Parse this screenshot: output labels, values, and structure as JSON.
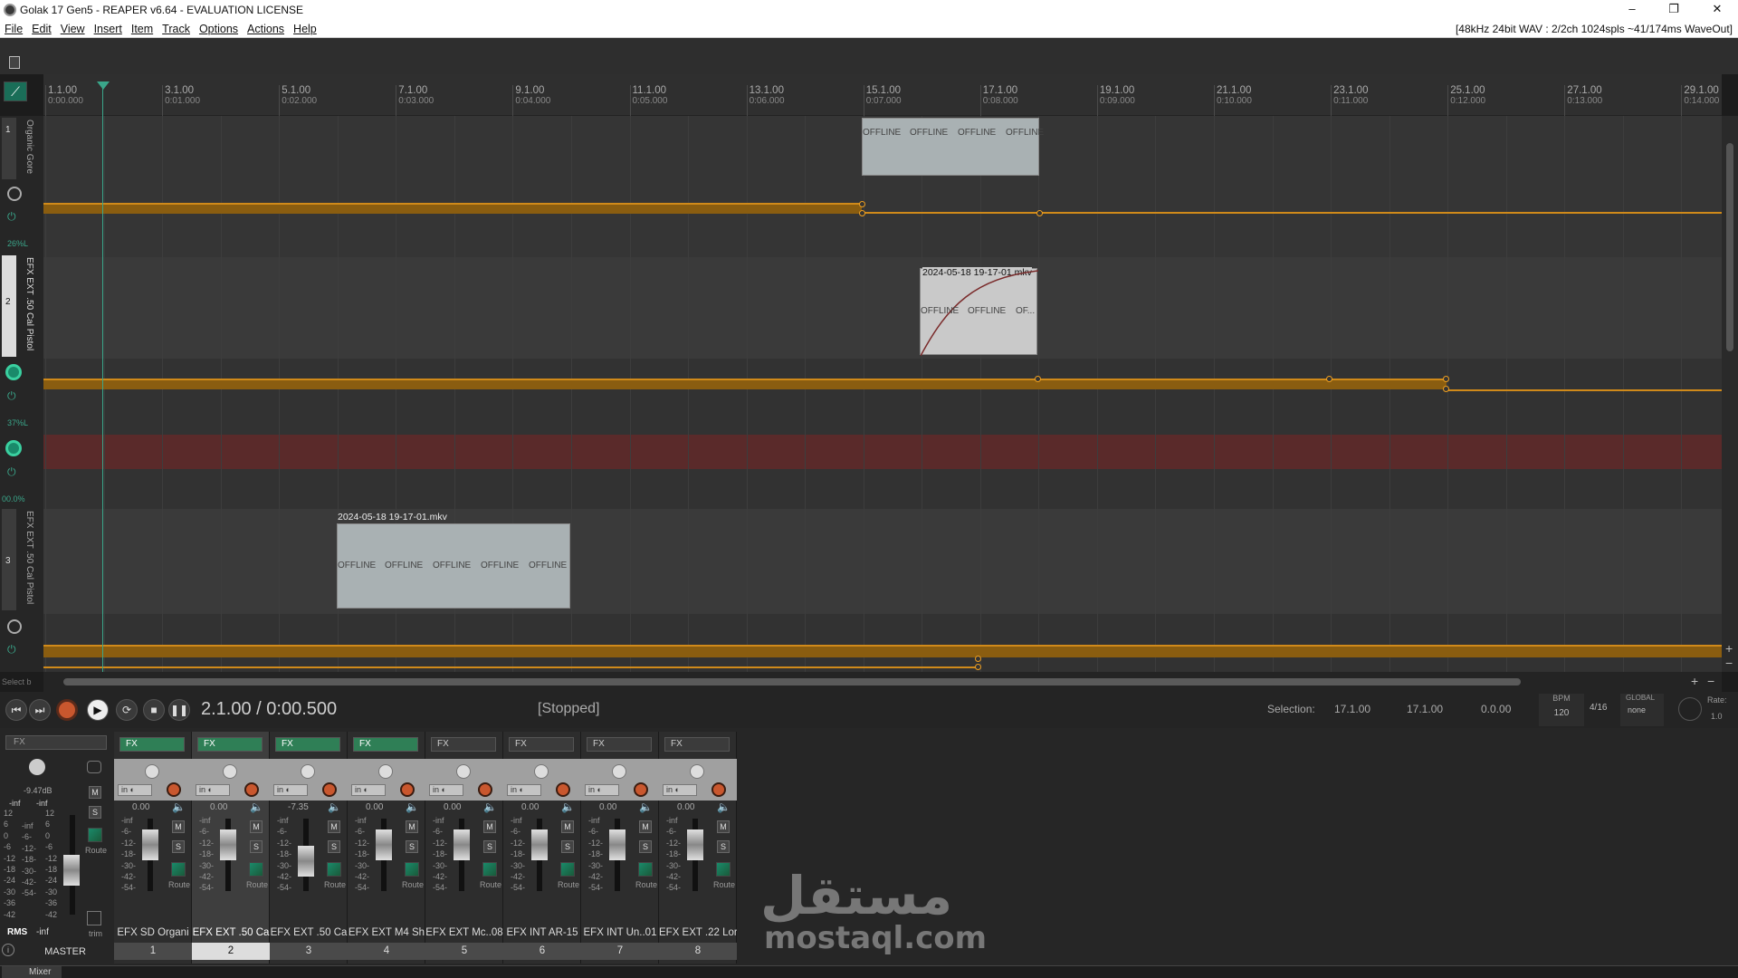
{
  "window": {
    "title": "Golak 17 Gen5 - REAPER v6.64 - EVALUATION LICENSE",
    "min": "–",
    "max": "❐",
    "close": "✕"
  },
  "menu": {
    "items": [
      "File",
      "Edit",
      "View",
      "Insert",
      "Item",
      "Track",
      "Options",
      "Actions",
      "Help"
    ],
    "audio_info": "[48kHz 24bit WAV : 2/2ch 1024spls ~41/174ms WaveOut]"
  },
  "ruler": {
    "marks": [
      {
        "bar": "1.1.00",
        "time": "0:00.000"
      },
      {
        "bar": "3.1.00",
        "time": "0:01.000"
      },
      {
        "bar": "5.1.00",
        "time": "0:02.000"
      },
      {
        "bar": "7.1.00",
        "time": "0:03.000"
      },
      {
        "bar": "9.1.00",
        "time": "0:04.000"
      },
      {
        "bar": "11.1.00",
        "time": "0:05.000"
      },
      {
        "bar": "13.1.00",
        "time": "0:06.000"
      },
      {
        "bar": "15.1.00",
        "time": "0:07.000"
      },
      {
        "bar": "17.1.00",
        "time": "0:08.000"
      },
      {
        "bar": "19.1.00",
        "time": "0:09.000"
      },
      {
        "bar": "21.1.00",
        "time": "0:10.000"
      },
      {
        "bar": "23.1.00",
        "time": "0:11.000"
      },
      {
        "bar": "25.1.00",
        "time": "0:12.000"
      },
      {
        "bar": "27.1.00",
        "time": "0:13.000"
      },
      {
        "bar": "29.1.00",
        "time": "0:14.000"
      }
    ]
  },
  "tracks": [
    {
      "num": "1",
      "name": "Organic Gore",
      "pan": "26%L"
    },
    {
      "num": "2",
      "name": "EFX EXT .50 Cal Pistol",
      "pan": "37%L"
    },
    {
      "num": "3",
      "name": "EFX EXT .50 Cal Pistol",
      "pan": "00.0%"
    }
  ],
  "items": {
    "offline": "OFFLINE",
    "offline_short": "OF...",
    "item2_name": "2024-05-18 19-17-01.mkv",
    "item3_name": "2024-05-18 19-17-01.mkv"
  },
  "hscroll_label": "Select b",
  "transport": {
    "position": "2.1.00 / 0:00.500",
    "state": "[Stopped]",
    "selection_label": "Selection:",
    "sel_start": "17.1.00",
    "sel_end": "17.1.00",
    "sel_len": "0.0.00",
    "bpm_label": "BPM",
    "bpm": "120",
    "timesig": "4/16",
    "global_label": "GLOBAL",
    "global_value": "none",
    "rate_label": "Rate:",
    "rate": "1.0"
  },
  "master": {
    "fx": "FX",
    "db": "-9.47dB",
    "peakL": "-inf",
    "peakR": "-inf",
    "rms": "RMS",
    "rms_val": "-inf",
    "name": "MASTER",
    "m": "M",
    "s": "S",
    "route": "Route",
    "trim": "trim",
    "scale_left": [
      "12",
      "6",
      "0",
      "-6",
      "-12",
      "-18",
      "-24",
      "-30",
      "-36",
      "-42"
    ],
    "scale_mid": [
      "-inf",
      "-6-",
      "-12-",
      "-18-",
      "-30-",
      "-42-",
      "-54-"
    ],
    "scale_right": [
      "12",
      "6",
      "0",
      "-6",
      "-12",
      "-18",
      "-24",
      "-30",
      "-36",
      "-42"
    ]
  },
  "strips": [
    {
      "num": "1",
      "name": "EFX SD Organi",
      "vol": "0.00",
      "fx_on": true
    },
    {
      "num": "2",
      "name": "EFX EXT .50 Ca",
      "vol": "0.00",
      "fx_on": true
    },
    {
      "num": "3",
      "name": "EFX EXT .50 Ca",
      "vol": "-7.35",
      "fx_on": true
    },
    {
      "num": "4",
      "name": "EFX EXT M4 Sh",
      "vol": "0.00",
      "fx_on": true
    },
    {
      "num": "5",
      "name": "EFX EXT Mc..08",
      "vol": "0.00",
      "fx_on": false
    },
    {
      "num": "6",
      "name": "EFX INT AR-15",
      "vol": "0.00",
      "fx_on": false
    },
    {
      "num": "7",
      "name": "EFX INT Un..01",
      "vol": "0.00",
      "fx_on": false
    },
    {
      "num": "8",
      "name": "EFX EXT .22 Lor",
      "vol": "0.00",
      "fx_on": false
    }
  ],
  "strip_labels": {
    "fx": "FX",
    "in": "in",
    "m": "M",
    "s": "S",
    "route": "Route",
    "inf": "-inf",
    "scale": [
      "-6-",
      "-12-",
      "-18-",
      "-30-",
      "-42-",
      "-54-"
    ]
  },
  "bottom": {
    "mixer_tab": "Mixer"
  },
  "watermark": {
    "arabic": "مستقل",
    "latin": "mostaql.com"
  },
  "colors": {
    "accent": "#2f7f56",
    "envelope": "#d08a1a",
    "item": "#a9b1b3",
    "record": "#c9572e"
  }
}
